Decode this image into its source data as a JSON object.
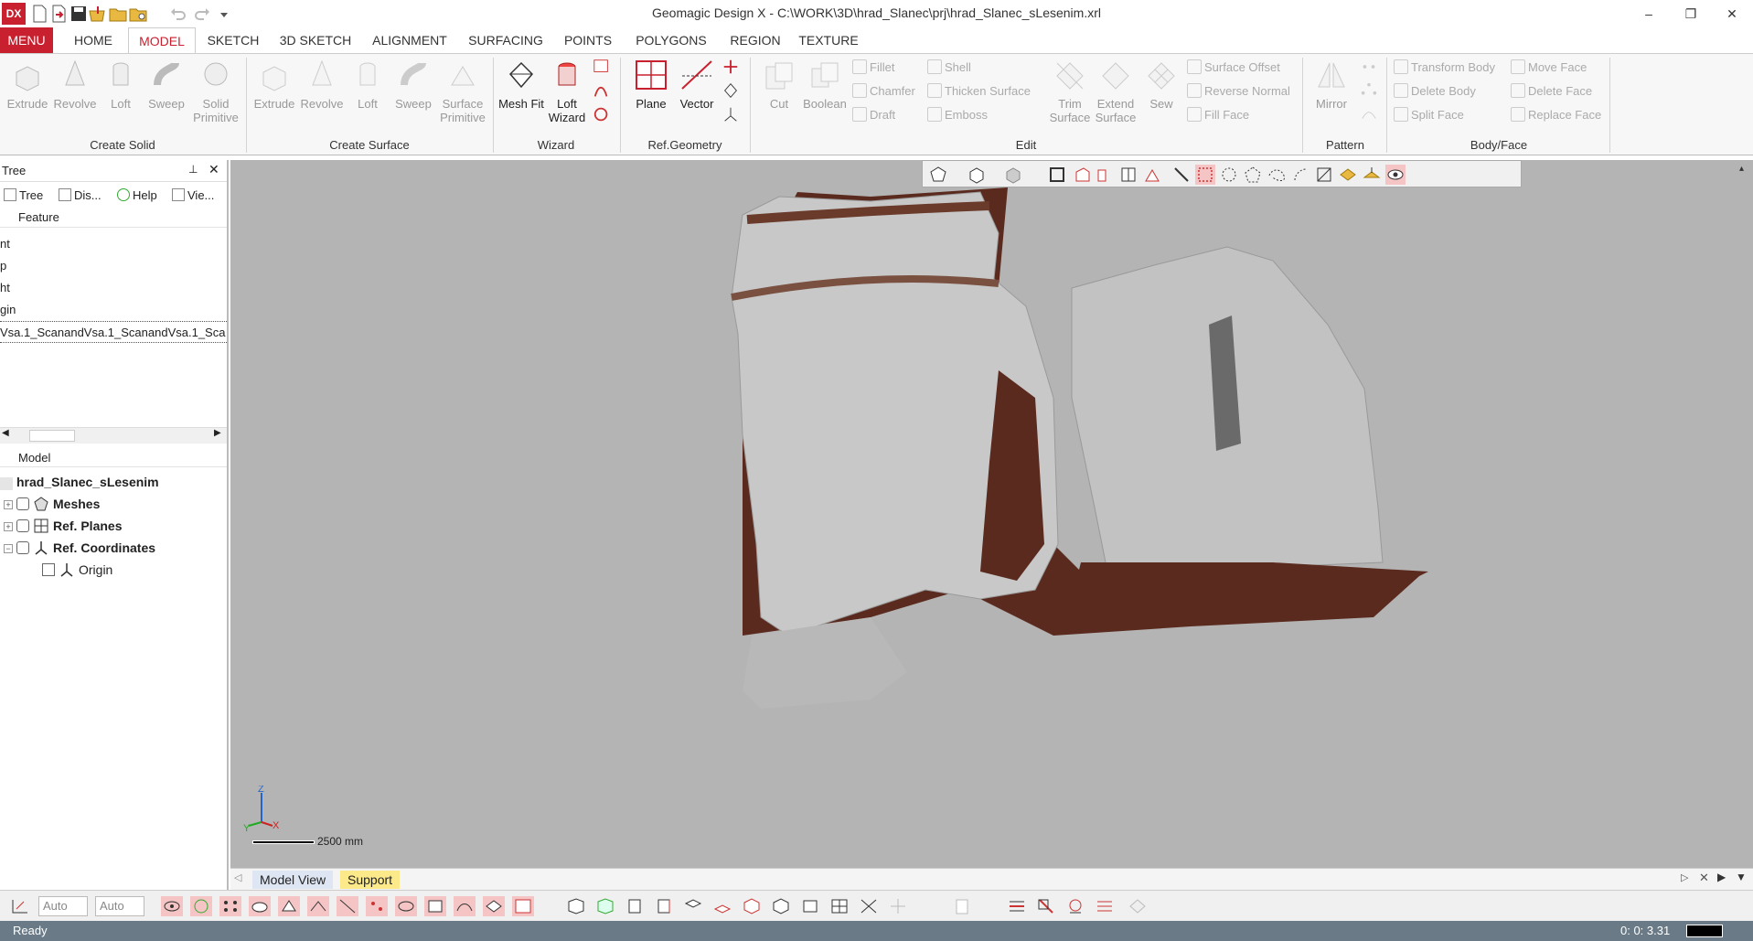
{
  "app": {
    "logo": "DX",
    "title": "Geomagic Design X - C:\\WORK\\3D\\hrad_Slanec\\prj\\hrad_Slanec_sLesenim.xrl"
  },
  "window_controls": {
    "minimize": "–",
    "restore": "❐",
    "close": "✕"
  },
  "tabs": [
    "MENU",
    "HOME",
    "MODEL",
    "SKETCH",
    "3D SKETCH",
    "ALIGNMENT",
    "SURFACING",
    "POINTS",
    "POLYGONS",
    "REGION",
    "TEXTURE"
  ],
  "active_tab": "MODEL",
  "ribbon": {
    "create_solid": {
      "label": "Create Solid",
      "buttons": [
        "Extrude",
        "Revolve",
        "Loft",
        "Sweep",
        "Solid Primitive"
      ]
    },
    "create_surface": {
      "label": "Create Surface",
      "buttons": [
        "Extrude",
        "Revolve",
        "Loft",
        "Sweep",
        "Surface Primitive"
      ]
    },
    "wizard": {
      "label": "Wizard",
      "buttons": [
        "Mesh Fit",
        "Loft Wizard"
      ]
    },
    "ref_geometry": {
      "label": "Ref.Geometry",
      "buttons": [
        "Plane",
        "Vector"
      ]
    },
    "edit": {
      "label": "Edit",
      "big": [
        "Cut",
        "Boolean",
        "Trim Surface",
        "Extend Surface",
        "Sew"
      ],
      "small": [
        "Fillet",
        "Chamfer",
        "Draft",
        "Shell",
        "Thicken Surface",
        "Emboss",
        "Surface Offset",
        "Reverse Normal",
        "Fill Face"
      ]
    },
    "pattern": {
      "label": "Pattern",
      "buttons": [
        "Mirror"
      ]
    },
    "body_face": {
      "label": "Body/Face",
      "small": [
        "Transform Body",
        "Delete Body",
        "Split Face",
        "Move Face",
        "Delete Face",
        "Replace Face"
      ]
    }
  },
  "left_panel": {
    "title": "Tree",
    "tabs": [
      "Tree",
      "Dis...",
      "Help",
      "Vie..."
    ],
    "feature_header": "Feature",
    "feature_rows": [
      "nt",
      "p",
      "ht",
      "gin",
      "Vsa.1_ScanandVsa.1_ScanandVsa.1_Sca"
    ],
    "model_header": "Model",
    "model_root": "hrad_Slanec_sLesenim",
    "model_items": [
      "Meshes",
      "Ref. Planes",
      "Ref. Coordinates",
      "Origin"
    ]
  },
  "viewport": {
    "background": "#b4b4b4",
    "mesh_color": "#c8c8c8",
    "backface_color": "#5a2a1e",
    "scale_label": "2500 mm",
    "axis_labels": {
      "z": "Z",
      "y": "Y",
      "x": "X"
    }
  },
  "view_tabs": [
    "Model View",
    "Support"
  ],
  "bottom_bar": {
    "combo1": "Auto",
    "combo2": "Auto"
  },
  "status": {
    "text": "Ready",
    "time": "0: 0: 3.31"
  }
}
